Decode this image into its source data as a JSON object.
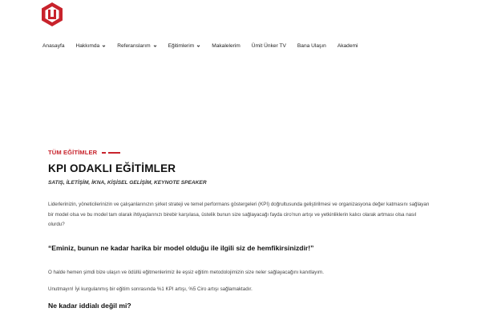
{
  "brand": {
    "color": "#c8232c",
    "logo_icon": "hexagon-logo-icon"
  },
  "nav": {
    "items": [
      {
        "label": "Anasayfa",
        "dropdown": false
      },
      {
        "label": "Hakkımda",
        "dropdown": true
      },
      {
        "label": "Referanslarım",
        "dropdown": true
      },
      {
        "label": "Eğitimlerim",
        "dropdown": true
      },
      {
        "label": "Makalelerim",
        "dropdown": false
      },
      {
        "label": "Ümit Ünker TV",
        "dropdown": false
      },
      {
        "label": "Bana Ulaşın",
        "dropdown": false
      },
      {
        "label": "Akademi",
        "dropdown": false
      }
    ]
  },
  "content": {
    "eyebrow": "TÜM EĞİTİMLER",
    "title": "KPI ODAKLI EĞİTİMLER",
    "tags": "SATIŞ, İLETİŞİM, İKNA, KİŞİSEL GELİŞİM, KEYNOTE SPEAKER",
    "paragraph1": "Liderlerinizin, yöneticilerinizin ve çalışanlarınızın şirket strateji ve temel performans göstergeleri (KPI) doğrultusunda geliştirilmesi ve organizasyona değer katmasını sağlayan bir model olsa ve bu model tam olarak ihtiyaçlarınızı birebir karşılasa, üstelik bunun size sağlayacağı fayda ciro'nun artışı ve yetkinliklerin kalıcı olarak artması olsa nasıl olurdu?",
    "quote": "“Eminiz, bunun ne kadar harika bir model olduğu ile ilgili siz de hemfikirsinizdir!”",
    "paragraph2": "O halde hemen şimdi bize ulaşın ve ödüllü eğitmenlerimiz ile eşsiz eğitim metodolojimizin size neler sağlayacağını kanıtlayım.",
    "paragraph3": "Unutmayın! İyi kurgulanmış bir eğitim sonrasında %1 KPI artışı, %5 Ciro artışı sağlamaktadır.",
    "heading3": "Ne kadar iddialı değil mi?"
  }
}
